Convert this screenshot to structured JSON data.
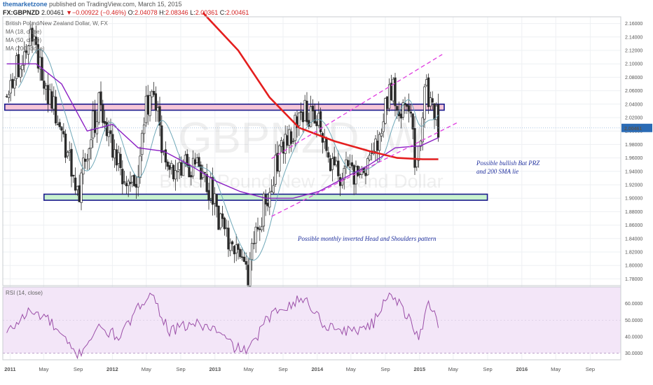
{
  "header": {
    "author": "themarketzone",
    "published": "published on TradingView.com, March 15, 2015",
    "symbol": "FX:GBPNZD",
    "last": "2.00461",
    "change": "−0.00922 (−0.46%)",
    "o_label": "O:",
    "o": "2.04078",
    "h_label": "H:",
    "h": "2.08346",
    "l_label": "L:",
    "l": "2.00361",
    "c_label": "C:",
    "c": "2.00461"
  },
  "legend": {
    "title": "British Pound/New Zealand Dollar, W, FX",
    "ma18": "MA (18, close)",
    "ma50": "MA (50, close)",
    "ma200": "MA (200, close)",
    "rsi": "RSI (14, close)"
  },
  "watermark": {
    "symbol": "GBPNZD, W",
    "name": "British Pound/New Zealand Dollar"
  },
  "annotations": {
    "bat": [
      "Possible bullish Bat PRZ",
      "and 200 SMA lie"
    ],
    "hs": "Possible monthly inverted Head and Shoulders pattern"
  },
  "colors": {
    "up": "#2b2b2b",
    "down": "#2b2b2b",
    "ma18": "#6fa8b8",
    "ma50": "#8b1fc4",
    "ma200": "#e41e1e",
    "channel": "#e03ce0",
    "resistance_fill": "#f6c6d8",
    "support_fill": "#c8f2cf",
    "zone_border": "#1a1a8c",
    "rsi_line": "#9b4fa8",
    "rsi_bg": "#f3e6f8",
    "price_badge": "#2a6bb5"
  },
  "chart_data": {
    "type": "candlestick",
    "timeframe": "W",
    "x_ticks": [
      "2011",
      "May",
      "Sep",
      "2012",
      "May",
      "Sep",
      "2013",
      "May",
      "Sep",
      "2014",
      "May",
      "Sep",
      "2015",
      "May",
      "Sep",
      "2016",
      "May",
      "Sep"
    ],
    "price_axis": {
      "ylim": [
        1.77,
        2.17
      ],
      "ticks": [
        "2.16000",
        "2.14000",
        "2.12000",
        "2.10000",
        "2.08000",
        "2.06000",
        "2.04000",
        "2.02000",
        "2.00000",
        "1.98000",
        "1.96000",
        "1.94000",
        "1.92000",
        "1.90000",
        "1.88000",
        "1.86000",
        "1.84000",
        "1.82000",
        "1.80000",
        "1.78000"
      ],
      "last_price": "2.00461"
    },
    "rsi_axis": {
      "ylim": [
        26,
        70
      ],
      "ticks": [
        "60.0000",
        "50.0000",
        "40.0000",
        "30.0000"
      ],
      "band": [
        30,
        70
      ]
    },
    "anchors": [
      {
        "t": "2010-12-20",
        "p": 2.05
      },
      {
        "t": "2011-01-31",
        "p": 2.1
      },
      {
        "t": "2011-03-14",
        "p": 2.15
      },
      {
        "t": "2011-04-11",
        "p": 2.105
      },
      {
        "t": "2011-05-30",
        "p": 2.04
      },
      {
        "t": "2011-07-25",
        "p": 1.96
      },
      {
        "t": "2011-09-05",
        "p": 1.905
      },
      {
        "t": "2011-10-10",
        "p": 1.99
      },
      {
        "t": "2011-11-14",
        "p": 2.04
      },
      {
        "t": "2011-12-26",
        "p": 1.99
      },
      {
        "t": "2012-02-20",
        "p": 1.91
      },
      {
        "t": "2012-03-26",
        "p": 1.93
      },
      {
        "t": "2012-04-30",
        "p": 2.03
      },
      {
        "t": "2012-05-28",
        "p": 2.05
      },
      {
        "t": "2012-07-02",
        "p": 1.96
      },
      {
        "t": "2012-09-10",
        "p": 1.94
      },
      {
        "t": "2012-10-29",
        "p": 1.955
      },
      {
        "t": "2012-12-17",
        "p": 1.91
      },
      {
        "t": "2013-02-04",
        "p": 1.84
      },
      {
        "t": "2013-04-08",
        "p": 1.8
      },
      {
        "t": "2013-04-29",
        "p": 1.79
      },
      {
        "t": "2013-06-24",
        "p": 1.89
      },
      {
        "t": "2013-08-12",
        "p": 1.96
      },
      {
        "t": "2013-10-07",
        "p": 2.0
      },
      {
        "t": "2013-11-25",
        "p": 2.03
      },
      {
        "t": "2014-01-13",
        "p": 2.0
      },
      {
        "t": "2014-03-03",
        "p": 1.935
      },
      {
        "t": "2014-05-05",
        "p": 1.94
      },
      {
        "t": "2014-06-30",
        "p": 1.95
      },
      {
        "t": "2014-08-18",
        "p": 1.98
      },
      {
        "t": "2014-09-15",
        "p": 2.075
      },
      {
        "t": "2014-10-27",
        "p": 2.03
      },
      {
        "t": "2014-11-24",
        "p": 2.04
      },
      {
        "t": "2014-12-22",
        "p": 1.935
      },
      {
        "t": "2015-01-19",
        "p": 2.075
      },
      {
        "t": "2015-02-16",
        "p": 2.04
      },
      {
        "t": "2015-03-09",
        "p": 2.005
      }
    ],
    "ma200": [
      {
        "t": "2012-11-19",
        "p": 2.176
      },
      {
        "t": "2013-03-25",
        "p": 2.12
      },
      {
        "t": "2013-07-15",
        "p": 2.05
      },
      {
        "t": "2013-10-28",
        "p": 2.005
      },
      {
        "t": "2014-03-03",
        "p": 1.985
      },
      {
        "t": "2014-07-07",
        "p": 1.97
      },
      {
        "t": "2014-10-13",
        "p": 1.96
      },
      {
        "t": "2015-01-12",
        "p": 1.958
      },
      {
        "t": "2015-03-09",
        "p": 1.958
      }
    ],
    "ma50": [
      {
        "t": "2010-12-20",
        "p": 2.1
      },
      {
        "t": "2011-04-04",
        "p": 2.1
      },
      {
        "t": "2011-07-04",
        "p": 2.07
      },
      {
        "t": "2011-10-03",
        "p": 2.0
      },
      {
        "t": "2012-01-02",
        "p": 2.01
      },
      {
        "t": "2012-04-02",
        "p": 1.975
      },
      {
        "t": "2012-07-02",
        "p": 1.97
      },
      {
        "t": "2012-10-01",
        "p": 1.95
      },
      {
        "t": "2013-01-07",
        "p": 1.925
      },
      {
        "t": "2013-04-01",
        "p": 1.91
      },
      {
        "t": "2013-07-01",
        "p": 1.9
      },
      {
        "t": "2013-10-07",
        "p": 1.9
      },
      {
        "t": "2014-01-06",
        "p": 1.91
      },
      {
        "t": "2014-04-07",
        "p": 1.93
      },
      {
        "t": "2014-07-07",
        "p": 1.95
      },
      {
        "t": "2014-10-06",
        "p": 1.975
      },
      {
        "t": "2015-01-05",
        "p": 1.978
      },
      {
        "t": "2015-03-09",
        "p": 1.99
      }
    ],
    "zones": [
      {
        "name": "resistance",
        "from": "2010-12-13",
        "to": "2015-03-30",
        "top": 2.04,
        "bottom": 2.031
      },
      {
        "name": "support",
        "from": "2011-05-02",
        "to": "2015-08-31",
        "top": 1.906,
        "bottom": 1.897
      }
    ],
    "channel": [
      {
        "from": {
          "t": "2013-07-22",
          "p": 1.959
        },
        "to": {
          "t": "2015-03-23",
          "p": 2.114
        }
      },
      {
        "from": {
          "t": "2013-07-22",
          "p": 1.873
        },
        "to": {
          "t": "2015-05-18",
          "p": 2.013
        }
      }
    ],
    "rsi_anchors": [
      {
        "t": "2010-12-20",
        "p": 42
      },
      {
        "t": "2011-03-07",
        "p": 55
      },
      {
        "t": "2011-05-09",
        "p": 52
      },
      {
        "t": "2011-08-29",
        "p": 28
      },
      {
        "t": "2011-11-07",
        "p": 45
      },
      {
        "t": "2012-01-30",
        "p": 40
      },
      {
        "t": "2012-05-14",
        "p": 68
      },
      {
        "t": "2012-07-23",
        "p": 43
      },
      {
        "t": "2012-10-15",
        "p": 48
      },
      {
        "t": "2012-12-24",
        "p": 45
      },
      {
        "t": "2013-03-18",
        "p": 33
      },
      {
        "t": "2013-05-06",
        "p": 32
      },
      {
        "t": "2013-06-24",
        "p": 48
      },
      {
        "t": "2013-08-26",
        "p": 58
      },
      {
        "t": "2013-11-18",
        "p": 63
      },
      {
        "t": "2014-01-27",
        "p": 47
      },
      {
        "t": "2014-04-28",
        "p": 43
      },
      {
        "t": "2014-07-21",
        "p": 48
      },
      {
        "t": "2014-09-15",
        "p": 68
      },
      {
        "t": "2014-11-17",
        "p": 53
      },
      {
        "t": "2014-12-29",
        "p": 38
      },
      {
        "t": "2015-02-02",
        "p": 62
      },
      {
        "t": "2015-03-09",
        "p": 48
      }
    ]
  }
}
